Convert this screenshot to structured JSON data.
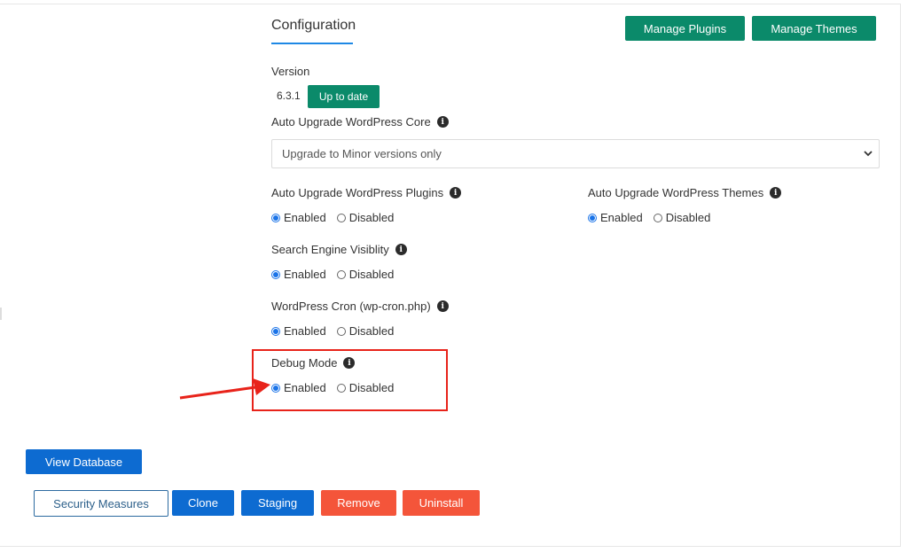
{
  "config": {
    "heading": "Configuration",
    "manage_plugins_label": "Manage Plugins",
    "manage_themes_label": "Manage Themes",
    "version_label": "Version",
    "version_value": "6.3.1",
    "version_status": "Up to date",
    "core_label": "Auto Upgrade WordPress Core",
    "core_selected": "Upgrade to Minor versions only",
    "plugins_label": "Auto Upgrade WordPress Plugins",
    "themes_label": "Auto Upgrade WordPress Themes",
    "search_label": "Search Engine Visiblity",
    "cron_label": "WordPress Cron (wp-cron.php)",
    "debug_label": "Debug Mode",
    "enabled_label": "Enabled",
    "disabled_label": "Disabled",
    "info_glyph": "i"
  },
  "actions": {
    "view_database": "View Database",
    "security_measures": "Security Measures",
    "clone": "Clone",
    "staging": "Staging",
    "remove": "Remove",
    "uninstall": "Uninstall"
  },
  "colors": {
    "green": "#0b8a6a",
    "blue": "#0d6bd1",
    "red": "#f4553a",
    "highlight": "#e8231a",
    "radio_accent": "#1a73e8"
  }
}
